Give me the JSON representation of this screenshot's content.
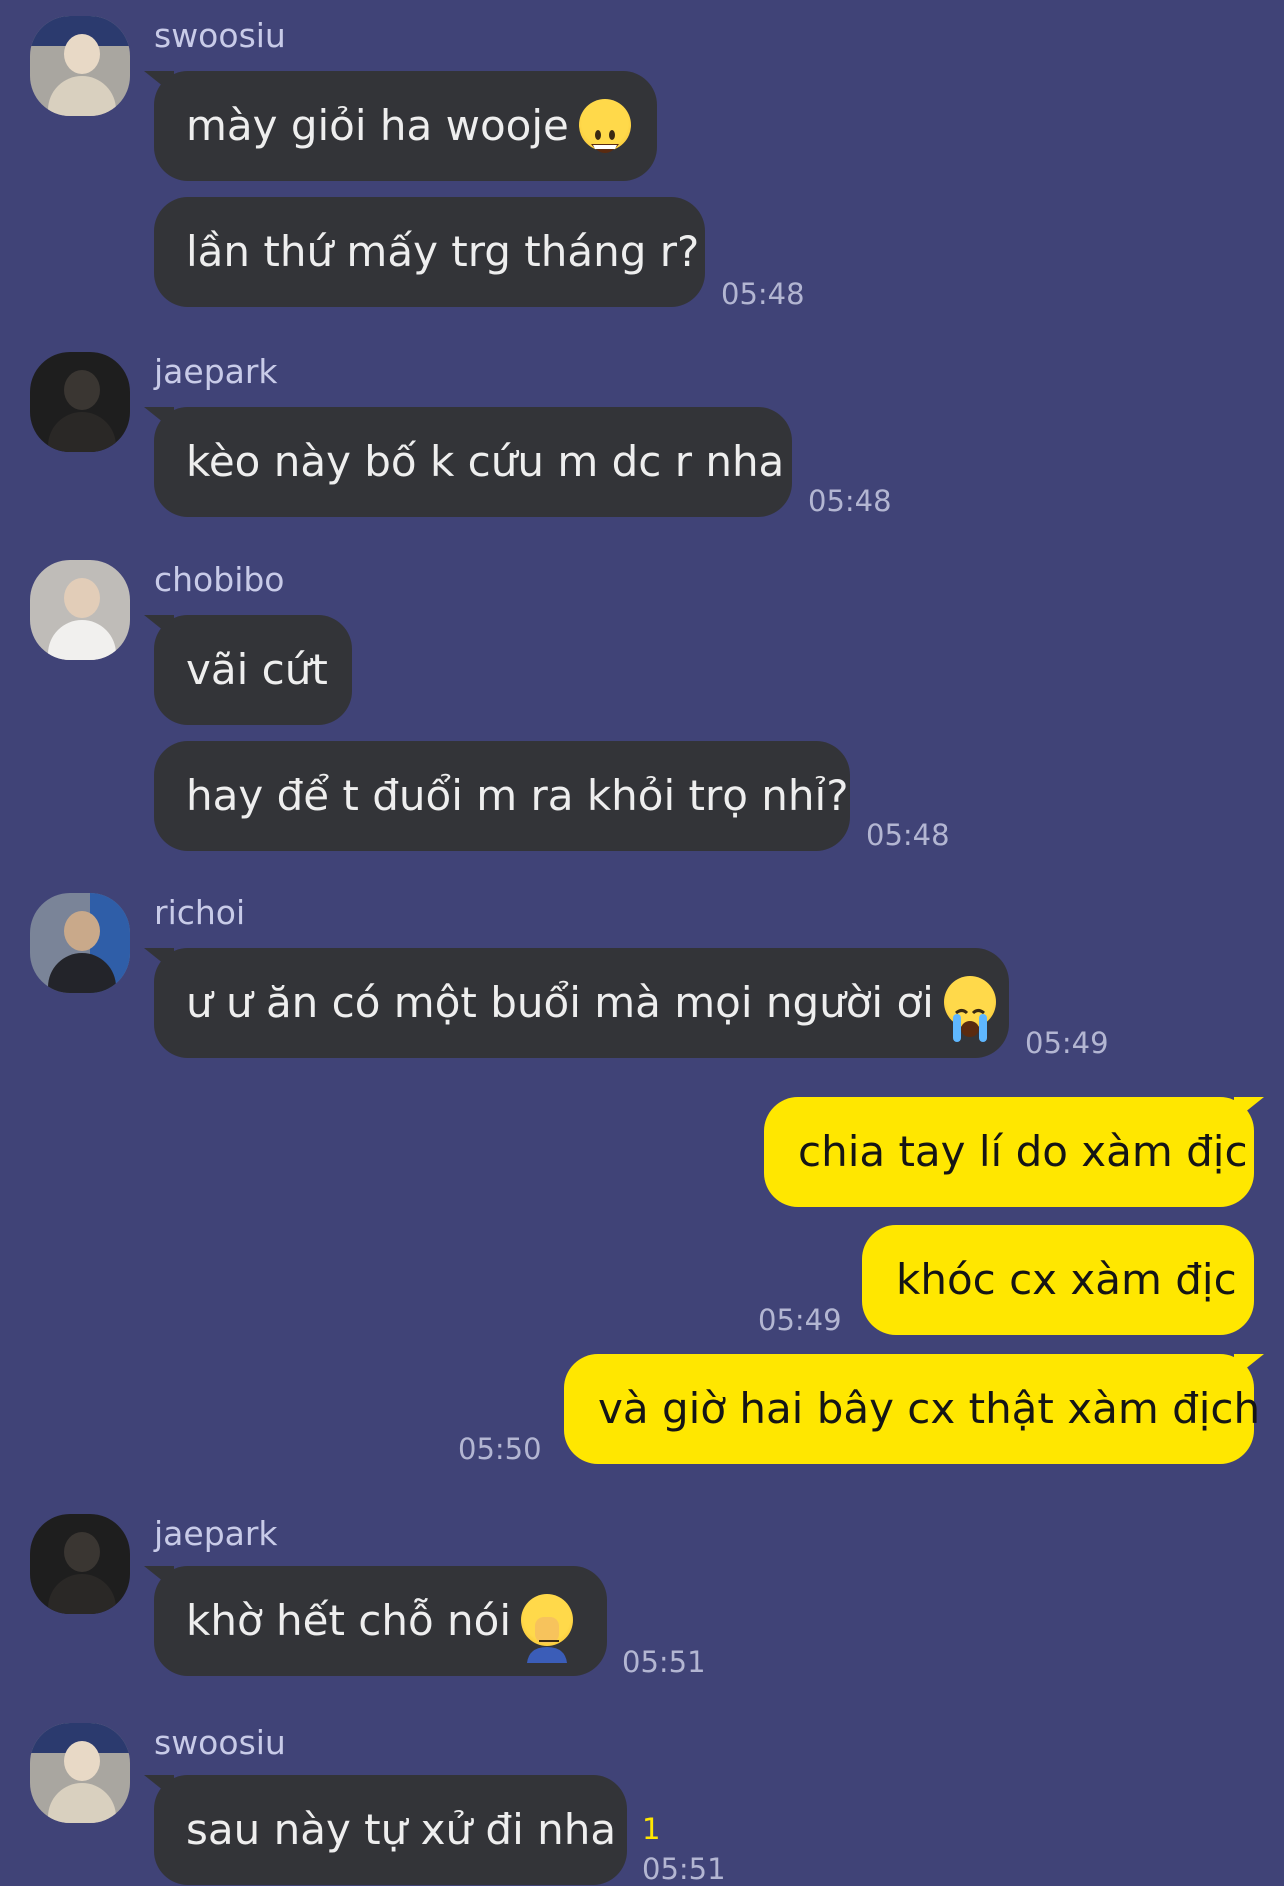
{
  "colors": {
    "background": "#404377",
    "incoming_bubble": "#333438",
    "outgoing_bubble": "#ffe700",
    "timestamp": "#b3b6d2",
    "unread": "#ffe700"
  },
  "messages": {
    "g1": {
      "sender": "swoosiu",
      "bubbles": [
        "mày giỏi ha wooje",
        "lần thứ mấy trg tháng r?"
      ],
      "time": "05:48",
      "emoji": "grinning-face-icon"
    },
    "g2": {
      "sender": "jaepark",
      "bubbles": [
        "kèo này bố k cứu m dc r nha"
      ],
      "time": "05:48"
    },
    "g3": {
      "sender": "chobibo",
      "bubbles": [
        "vãi cứt",
        "hay để t đuổi m ra khỏi trọ nhỉ?"
      ],
      "time": "05:48"
    },
    "g4": {
      "sender": "richoi",
      "bubbles": [
        "ư ư ăn có một buổi mà mọi người ơi"
      ],
      "time": "05:49",
      "emoji": "loudly-crying-face-icon"
    },
    "out": {
      "bubbles": [
        "chia tay lí do xàm địc",
        "khóc cx xàm địc",
        "và giờ hai bây cx thật xàm địch"
      ],
      "times": [
        "05:49",
        "05:50"
      ]
    },
    "g5": {
      "sender": "jaepark",
      "bubbles": [
        "khờ hết chỗ nói"
      ],
      "time": "05:51",
      "emoji": "face-palm-icon"
    },
    "g6": {
      "sender": "swoosiu",
      "bubbles": [
        "sau này tự xử đi nha"
      ],
      "time": "05:51",
      "unread": "1"
    }
  }
}
